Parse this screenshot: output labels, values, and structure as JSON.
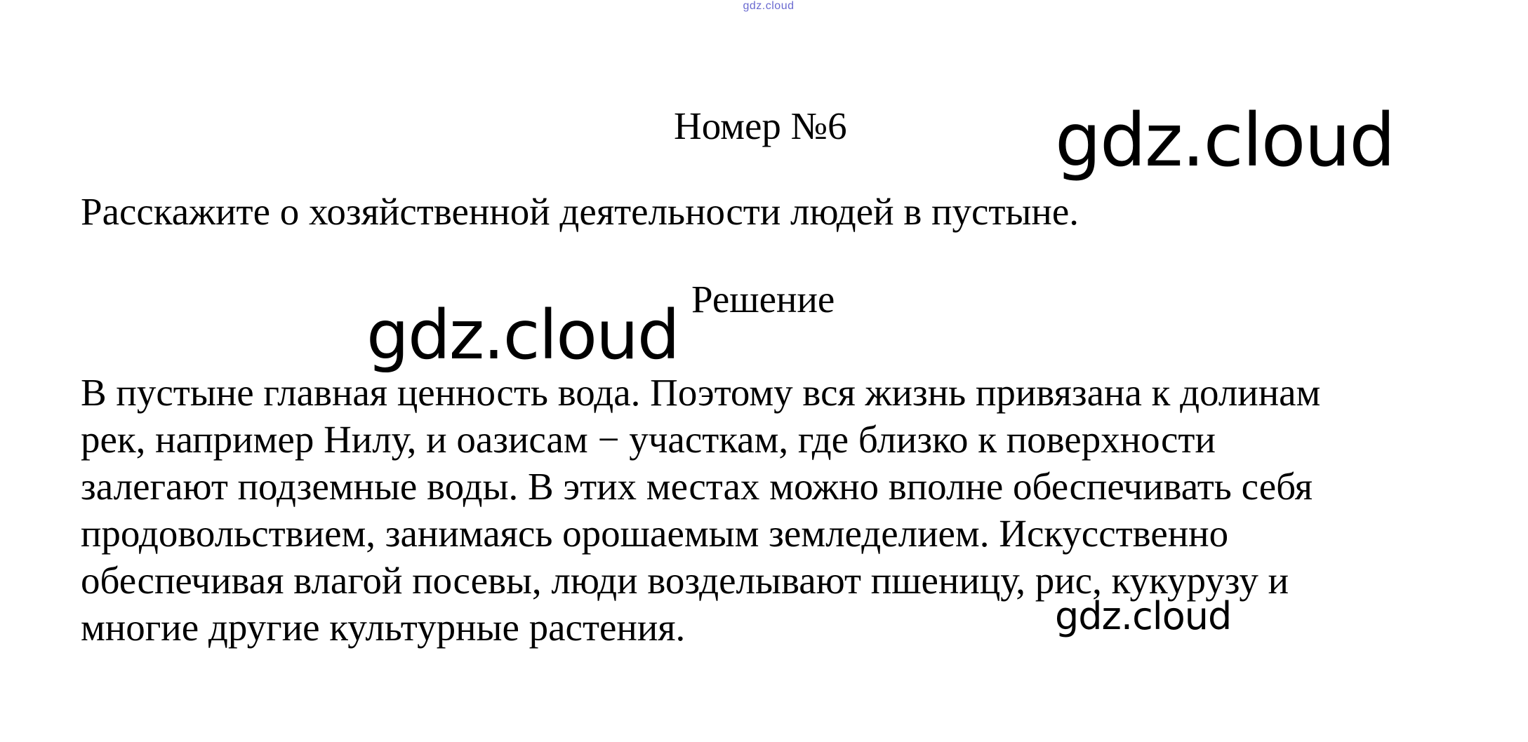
{
  "header": {
    "site_watermark_small": "gdz.cloud"
  },
  "watermarks": [
    "gdz.cloud",
    "gdz.cloud",
    "gdz.cloud"
  ],
  "task": {
    "number": "Номер №6",
    "question": "Расскажите о хозяйственной деятельности людей в пустыне."
  },
  "solution": {
    "title": "Решение",
    "lines": [
      "В пустыне главная ценность вода. Поэтому вся жизнь привязана к долинам",
      "рек, например Нилу, и оазисам − участкам, где близко к поверхности",
      "залегают подземные воды. В этих местах можно вполне обеспечивать себя",
      "продовольствием, занимаясь орошаемым земледелием. Искусственно",
      "обеспечивая влагой посевы, люди возделывают пшеницу, рис, кукурузу и",
      "многие другие культурные растения."
    ]
  }
}
